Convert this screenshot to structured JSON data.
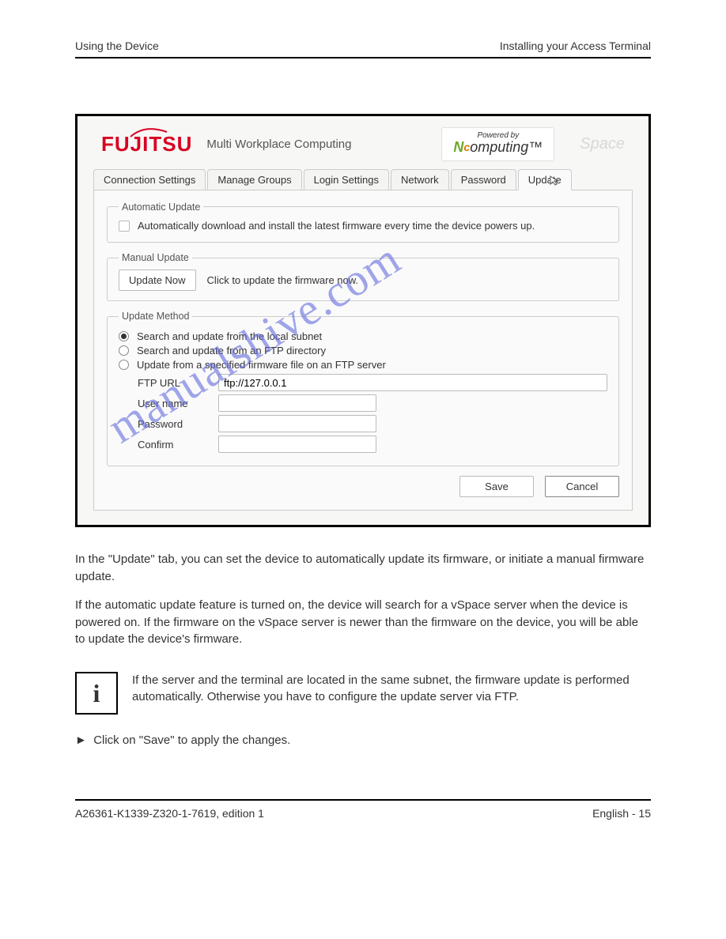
{
  "header": {
    "left": "Using the Device",
    "right": "Installing your Access Terminal"
  },
  "footer": {
    "left": "A26361-K1339-Z320-1-7619, edition 1",
    "right": "English - 15"
  },
  "watermark": "manualshive.com",
  "screenshot": {
    "brand": "FUJITSU",
    "brand_subtitle": "Multi Workplace Computing",
    "powered_by_small": "Powered by",
    "powered_by_main_pre": "N",
    "powered_by_main_mid": "c",
    "powered_by_main_rest": "omputing™",
    "ghost": "Space",
    "tabs": [
      {
        "label": "Connection Settings",
        "active": false
      },
      {
        "label": "Manage Groups",
        "active": false
      },
      {
        "label": "Login Settings",
        "active": false
      },
      {
        "label": "Network",
        "active": false
      },
      {
        "label": "Password",
        "active": false
      },
      {
        "label": "Update",
        "active": true
      }
    ],
    "auto": {
      "legend": "Automatic Update",
      "text": "Automatically download and install the latest firmware every time the device powers up."
    },
    "manual": {
      "legend": "Manual Update",
      "button": "Update Now",
      "text": "Click to update the firmware now."
    },
    "method": {
      "legend": "Update Method",
      "opt1": "Search and update from the local subnet",
      "opt2": "Search and update from an FTP directory",
      "opt3": "Update from a specified firmware file on an FTP server",
      "ftp_url_label": "FTP URL",
      "ftp_url_value": "ftp://127.0.0.1",
      "user_label": "User name",
      "pass_label": "Password",
      "confirm_label": "Confirm"
    },
    "actions": {
      "save": "Save",
      "cancel": "Cancel"
    }
  },
  "body": {
    "p1": "In the \"Update\" tab, you can set the device to automatically update its firmware, or initiate a manual firmware update.",
    "p2": "If the automatic update feature is turned on, the device will search for a vSpace server when the device is powered on. If the firmware on the vSpace server is newer than the firmware on the device, you will be able to update the device's firmware.",
    "info_icon": "i",
    "info_text": "If the server and the terminal are located in the same subnet, the firmware update is performed automatically. Otherwise you have to configure the update server via FTP.",
    "last": "Click on \"Save\" to apply the changes."
  }
}
